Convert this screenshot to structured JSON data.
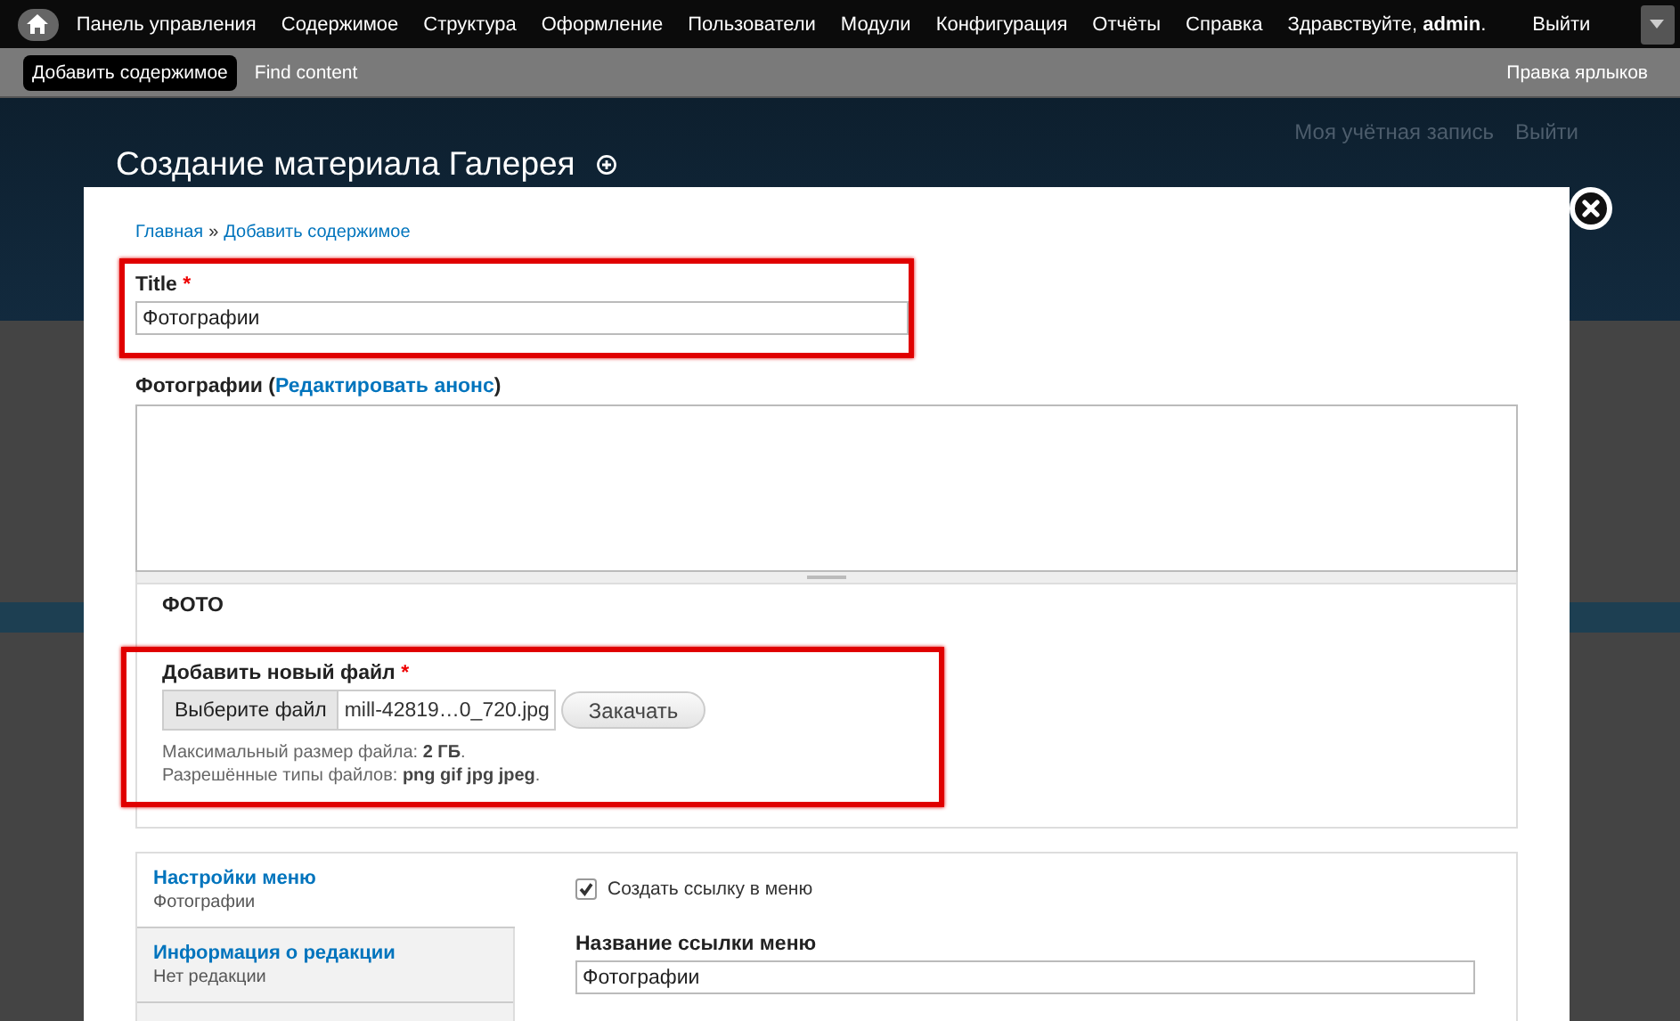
{
  "toolbar": {
    "items": [
      "Панель управления",
      "Содержимое",
      "Структура",
      "Оформление",
      "Пользователи",
      "Модули",
      "Конфигурация",
      "Отчёты",
      "Справка"
    ],
    "greeting": "Здравствуйте, **admin**.",
    "logout": "Выйти"
  },
  "shortcuts": {
    "items": [
      {
        "label": "Добавить содержимое",
        "selected": true
      },
      {
        "label": "Find content",
        "selected": false
      }
    ],
    "edit_link": "Правка ярлыков"
  },
  "background_page": {
    "user_links": [
      "Моя учётная запись",
      "Выйти"
    ],
    "title": "Создание материала Галерея"
  },
  "dialog": {
    "breadcrumb": [
      "Главная",
      "Добавить содержимое"
    ],
    "breadcrumb_separator": "»",
    "title_field": {
      "label": "Title",
      "required_mark": "*",
      "value": "Фотографии",
      "highlighted": true
    },
    "body_field": {
      "label_prefix": "Фотографии (",
      "summary_link": "Редактировать анонс",
      "label_suffix": ")"
    },
    "photo": {
      "legend": "ФОТО",
      "label": "Добавить новый файл",
      "required_mark": "*",
      "highlighted": true,
      "choose_button": "Выберите файл",
      "file_name": "mill-42819…0_720.jpg",
      "upload_button": "Закачать",
      "help": [
        "Максимальный размер файла: **2 ГБ**.",
        "Разрешённые типы файлов: **png gif jpg jpeg**."
      ]
    },
    "vertical_tabs": {
      "tabs": [
        {
          "title": "Настройки меню",
          "summary": "Фотографии",
          "selected": true
        },
        {
          "title": "Информация о редакции",
          "summary": "Нет редакции",
          "selected": false
        }
      ],
      "create_link": {
        "label": "Создать ссылку в меню",
        "checked": true
      },
      "link_title": {
        "label": "Название ссылки меню",
        "value": "Фотографии"
      }
    }
  }
}
